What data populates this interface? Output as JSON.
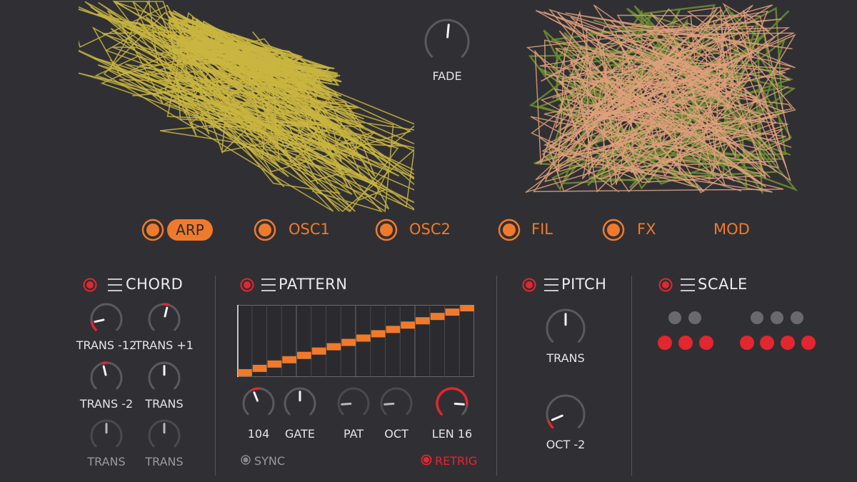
{
  "top": {
    "fade_label": "FADE",
    "fade_value": 0.52
  },
  "tabs": [
    {
      "label": "ARP",
      "active": true
    },
    {
      "label": "OSC1",
      "active": false
    },
    {
      "label": "OSC2",
      "active": false
    },
    {
      "label": "FIL",
      "active": false
    },
    {
      "label": "FX",
      "active": false
    },
    {
      "label": "MOD",
      "active": false
    }
  ],
  "chord": {
    "title": "CHORD",
    "knobs": [
      {
        "label": "TRANS -12",
        "value": 0.12,
        "active": true
      },
      {
        "label": "TRANS +1",
        "value": 0.55,
        "active": true
      },
      {
        "label": "TRANS -2",
        "value": 0.45,
        "active": true
      },
      {
        "label": "TRANS",
        "value": 0.5,
        "active": true
      },
      {
        "label": "TRANS",
        "value": 0.5,
        "active": false
      },
      {
        "label": "TRANS",
        "value": 0.5,
        "active": false
      }
    ]
  },
  "pattern": {
    "title": "PATTERN",
    "steps": [
      0.06,
      0.12,
      0.18,
      0.24,
      0.3,
      0.36,
      0.42,
      0.48,
      0.54,
      0.6,
      0.66,
      0.72,
      0.78,
      0.84,
      0.9,
      0.96
    ],
    "knobs": [
      {
        "label": "104",
        "value": 0.42,
        "active": true
      },
      {
        "label": "GATE",
        "value": 0.5,
        "active": true
      },
      {
        "label": "PAT",
        "value": 0.15,
        "active": false
      },
      {
        "label": "OCT",
        "value": 0.15,
        "active": false
      },
      {
        "label": "LEN 16",
        "value": 0.85,
        "active": true
      }
    ],
    "sync_label": "SYNC",
    "retrig_label": "RETRIG"
  },
  "pitch": {
    "title": "PITCH",
    "knobs": [
      {
        "label": "TRANS",
        "value": 0.5,
        "active": true
      },
      {
        "label": "OCT -2",
        "value": 0.08,
        "active": true
      }
    ]
  },
  "scale": {
    "title": "SCALE",
    "black_keys": [
      false,
      false,
      false,
      false,
      false
    ],
    "white_keys": [
      true,
      true,
      true,
      true,
      true,
      true,
      true
    ]
  },
  "colors": {
    "accent": "#f07a2c",
    "red": "#e3262f",
    "bg": "#303034",
    "scribble_left": "#c9b53f",
    "scribble_right_a": "#e0a07c",
    "scribble_right_b": "#6e8f32"
  }
}
